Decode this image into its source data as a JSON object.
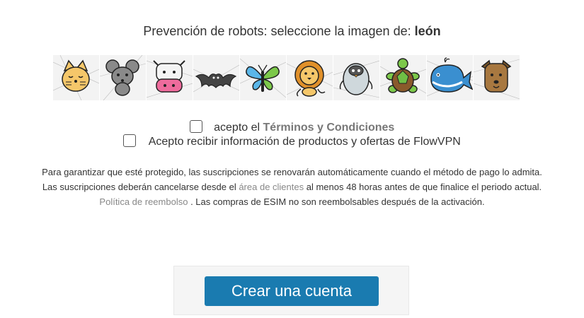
{
  "captcha": {
    "prompt_prefix": "Prevención de robots: seleccione la imagen de:",
    "target": "león",
    "images": [
      {
        "name": "cat-icon",
        "color": "#f5c76a"
      },
      {
        "name": "mouse-icon",
        "color": "#8a8a8a"
      },
      {
        "name": "cow-icon",
        "color": "#ee6b9c"
      },
      {
        "name": "bat-icon",
        "color": "#444444"
      },
      {
        "name": "butterfly-icon",
        "color": "#5ab6e8"
      },
      {
        "name": "lion-icon",
        "color": "#f0a53b"
      },
      {
        "name": "penguin-icon",
        "color": "#cfd8dc"
      },
      {
        "name": "turtle-icon",
        "color": "#6fbf45"
      },
      {
        "name": "whale-icon",
        "color": "#3a8fd0"
      },
      {
        "name": "dog-icon",
        "color": "#a87840"
      }
    ]
  },
  "terms": {
    "prefix": "acepto el",
    "link": "Términos y Condiciones"
  },
  "marketing": {
    "label": "Acepto recibir información de productos y ofertas de FlowVPN"
  },
  "notice": {
    "line1": "Para garantizar que esté protegido, las suscripciones se renovarán automáticamente cuando el método de pago lo admita.",
    "line2_pre": "Las suscripciones deberán cancelarse desde el",
    "line2_link": "área de clientes",
    "line2_post": "al menos 48 horas antes de que finalice el periodo actual.",
    "line3_link": "Política de reembolso",
    "line3_post": ". Las compras de ESIM no son reembolsables después de la activación."
  },
  "button": {
    "label": "Crear una cuenta",
    "color": "#1a7bb0"
  }
}
